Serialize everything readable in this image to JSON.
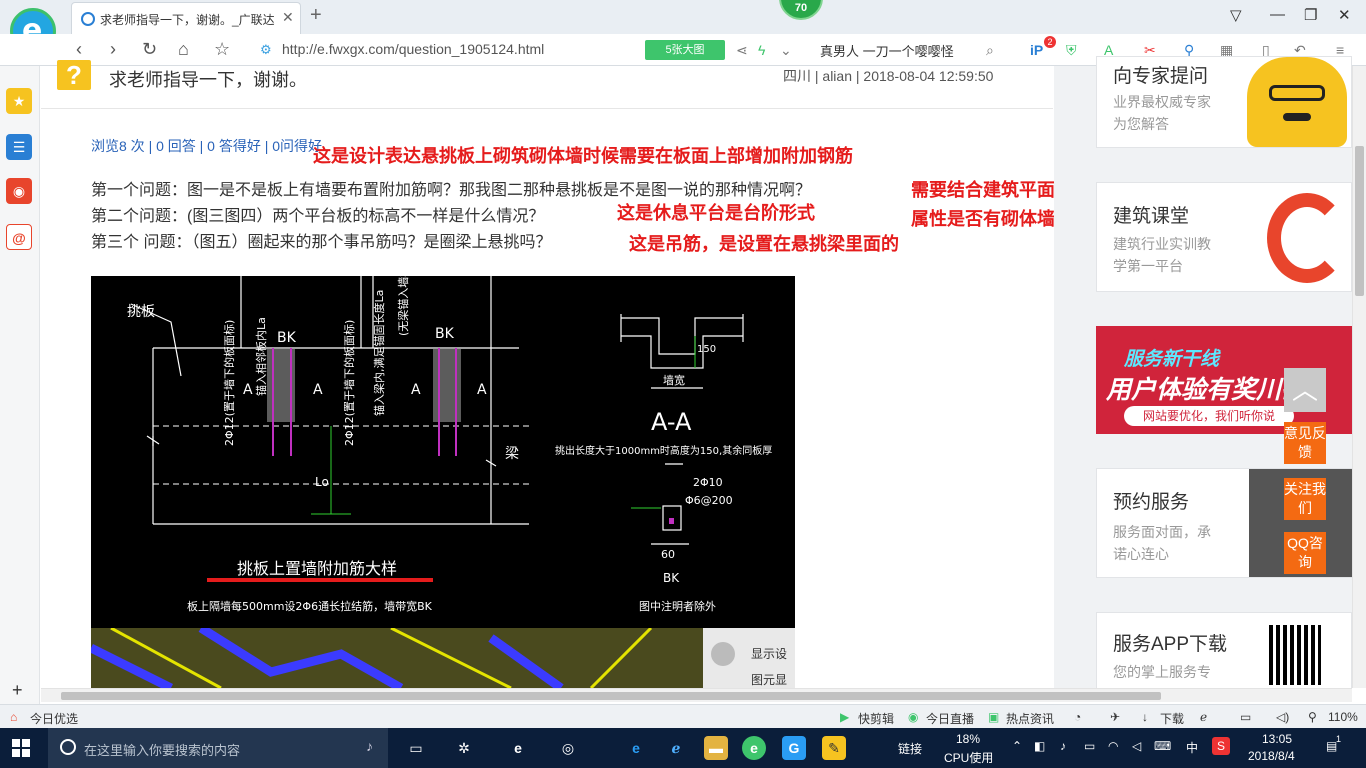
{
  "browser": {
    "tab_title": "求老师指导一下，谢谢。_广联达",
    "tab_close": "✕",
    "new_tab": "+",
    "badge": "70",
    "url": "http://e.fwxgx.com/question_1905124.html",
    "big_image_btn": "5张大图",
    "search_query": "真男人 一刀一个嘤嘤怪",
    "notify_count": "2"
  },
  "question": {
    "title": "求老师指导一下，谢谢。",
    "meta": "四川 | alian | 2018-08-04 12:59:50",
    "stats": "浏览8 次 | 0 回答 | 0 答得好 | 0问得好",
    "lines": [
      "第一个问题：图一是不是板上有墙要布置附加筋啊？那我图二那种悬挑板是不是图一说的那种情况啊？",
      "第二个问题：(图三图四）两个平台板的标高不一样是什么情况？",
      "第三个 问题：（图五）圈起来的那个事吊筋吗？是圈梁上悬挑吗？"
    ]
  },
  "annotations": {
    "a1": "这是设计表达悬挑板上砌筑砌体墙时候需要在板面上部增加附加钢筋",
    "a2": "需要结合建筑平面查看",
    "a3": "属性是否有砌体墙",
    "a4": "这是休息平台是台阶形式",
    "a5": "这是吊筋，是设置在悬挑梁里面的"
  },
  "cad": {
    "label_tiaoban": "挑板",
    "label_bk1": "BK",
    "label_bk2": "BK",
    "label_a": "A",
    "label_liang": "梁",
    "label_lo": "Lo",
    "vertical_1": "2Φ12(置于墙下的板面标)",
    "vertical_2": "锚入相邻板内La",
    "vertical_3": "2Φ12(置于墙下的板面标)",
    "vertical_4": "锚入梁内,满足锚固长度La",
    "vertical_5": "(无梁锚入墙柱)",
    "caption": "挑板上置墙附加筋大样",
    "note": "板上隔墙每500mm设2Φ6通长拉结筋，墙带宽BK",
    "aa_title": "A-A",
    "wall_width": "墙宽",
    "dim_150": "150",
    "aa_note": "挑出长度大于1000mm时高度为150,其余同板厚",
    "rebar_top": "2Φ10",
    "rebar_stirrup": "Φ6@200",
    "dim_60": "60",
    "bk_bottom": "BK",
    "bk_note": "图中注明者除外",
    "panel_label1": "显示设",
    "panel_label2": "图元显"
  },
  "sidebar": {
    "expert_title": "向专家提问",
    "expert_sub1": "业界最权威专家",
    "expert_sub2": "为您解答",
    "course_title": "建筑课堂",
    "course_sub1": "建筑行业实训教",
    "course_sub2": "学第一平台",
    "promo_line1": "服务新干线",
    "promo_line2": "用户体验有奖川研",
    "promo_line3": "网站要优化，我们听你说",
    "booking_title": "预约服务",
    "booking_sub1": "服务面对面，承",
    "booking_sub2": "诺心连心",
    "app_title": "服务APP下载",
    "app_sub1": "您的掌上服务专"
  },
  "floating": {
    "feedback": "意见反馈",
    "follow": "关注我们",
    "qq": "QQ咨询"
  },
  "statusbar": {
    "today": "今日优选",
    "kuaijian": "快剪辑",
    "live": "今日直播",
    "news": "热点资讯",
    "download": "下载",
    "zoom": "110%"
  },
  "taskbar": {
    "search_placeholder": "在这里输入你要搜索的内容",
    "link": "链接",
    "cpu_pct": "18%",
    "cpu_label": "CPU使用",
    "ime": "中",
    "time": "13:05",
    "date": "2018/8/4",
    "notif": "1"
  },
  "colors": {
    "accent_green": "#3ec56c",
    "annotation_red": "#e51c1c",
    "link_blue": "#2a63b8",
    "float_orange": "#f46a12"
  }
}
